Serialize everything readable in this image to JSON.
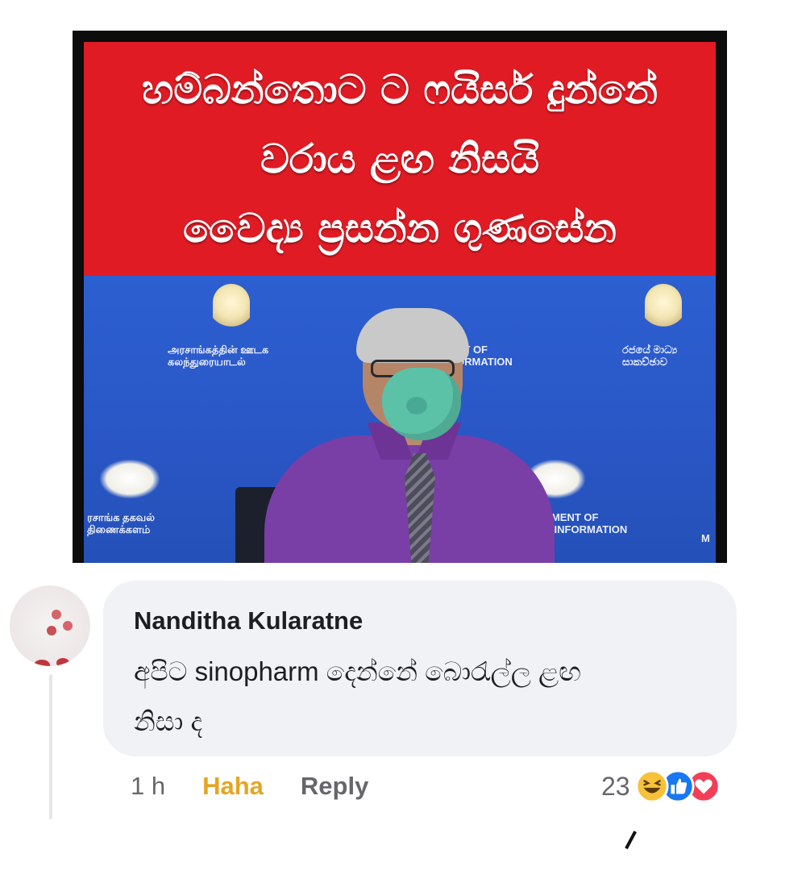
{
  "post": {
    "headline_lines": [
      "හම්බන්තොට ට ෆයිසර් දුන්නේ",
      "වරාය ළඟ නිසයි",
      "වෛද්‍ය ප්‍රසන්න ගුණසේන"
    ],
    "background_text": {
      "left_sinhala": [
        "அரசாங்கத்தின் ஊடக",
        "கலந்துரையாடல்"
      ],
      "center_english": [
        "NT OF",
        "ORMATION"
      ],
      "right_sinhala": [
        "රජයේ මාධ්‍ය",
        "සාකච්ඡාව"
      ],
      "bottom_left_tamil": [
        "ரசாங்க தகவல்",
        "திணைக்களம்"
      ],
      "bottom_right_english": [
        "TMENT OF",
        "T INFORMATION"
      ],
      "bottom_right_letter": "M"
    },
    "colors": {
      "headline_bg": "#e01b24",
      "photo_bg": "#2c5fd1",
      "frame": "#0c0c0c"
    }
  },
  "comment": {
    "author": "Nanditha Kularatne",
    "text_line1": "අපිට sinopharm දෙන්නේ බොරැල්ල ළඟ",
    "text_line2": "නිසා ද",
    "time": "1 h",
    "reaction_label": "Haha",
    "reply_label": "Reply",
    "reaction_count": "23",
    "reaction_icons": [
      "haha-icon",
      "like-icon",
      "love-icon"
    ],
    "colors": {
      "bubble_bg": "#f0f2f5",
      "haha": "#e4a524",
      "like": "#1877f2",
      "love": "#f33e58"
    }
  }
}
